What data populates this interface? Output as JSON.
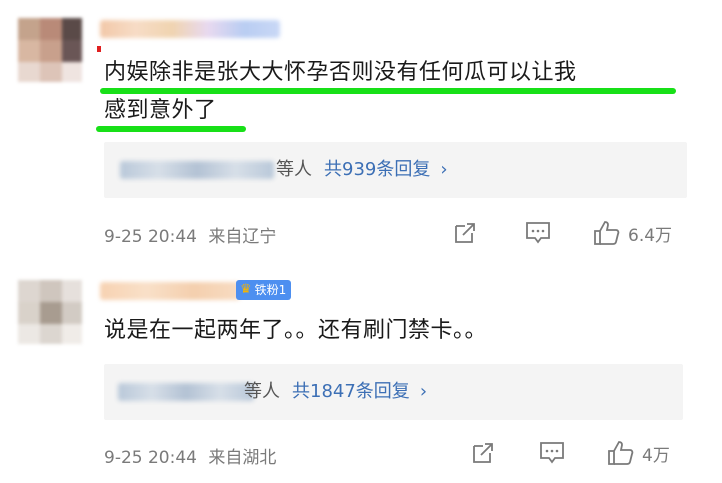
{
  "comments": [
    {
      "content_line1": "内娱除非是张大大怀孕否则没有任何瓜可以让我",
      "content_line2": "感到意外了",
      "reply_summary": {
        "who": "等人",
        "count": "共939条回复",
        "chevron": "›"
      },
      "time": "9-25 20:44",
      "location": "来自辽宁",
      "likes": "6.4万",
      "icons": [
        "share-icon",
        "comment-icon",
        "like-icon"
      ]
    },
    {
      "badge": "铁粉1",
      "content": "说是在一起两年了。。还有刷门禁卡。。",
      "reply_summary": {
        "who": "等人",
        "count": "共1847条回复",
        "chevron": "›"
      },
      "time": "9-25 20:44",
      "location": "来自湖北",
      "likes": "4万",
      "icons": [
        "share-icon",
        "comment-icon",
        "like-icon"
      ]
    }
  ],
  "colors": {
    "highlight": "#18e018",
    "link": "#3c6fb5",
    "badge": "#4d8ff0",
    "meta": "#7a7a7a"
  }
}
